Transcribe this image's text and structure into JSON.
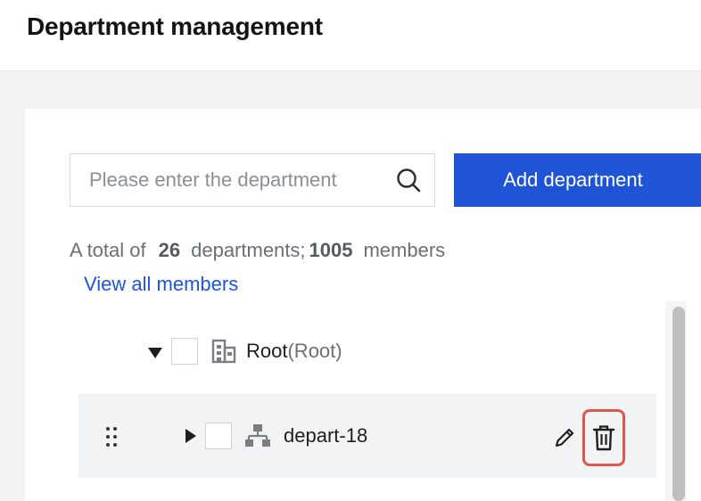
{
  "header": {
    "title": "Department management"
  },
  "toolbar": {
    "search_placeholder": "Please enter the department name",
    "add_label": "Add department"
  },
  "summary": {
    "prefix": "A total of",
    "department_count": "26",
    "departments_label": "departments;",
    "member_count": "1005",
    "members_label": "members",
    "view_all_label": "View all members"
  },
  "tree": {
    "root": {
      "name": "Root",
      "tag": "(Root)"
    },
    "children": [
      {
        "name": "depart-18"
      }
    ]
  },
  "colors": {
    "accent": "#1f54d6",
    "delete_highlight": "#e0564e"
  },
  "icons": {
    "search": "search-icon",
    "root": "building-icon",
    "department": "org-chart-icon",
    "drag": "drag-handle-icon",
    "edit": "pencil-icon",
    "delete": "trash-icon"
  }
}
